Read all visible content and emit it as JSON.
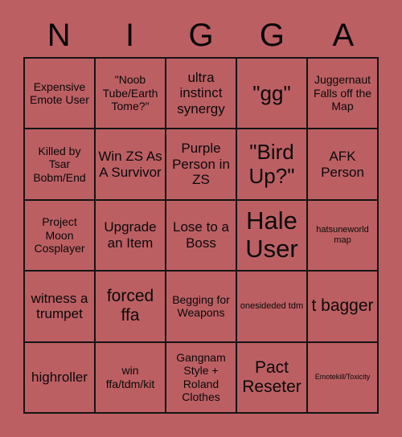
{
  "colors": {
    "background": "#bc5f63",
    "cell_background": "#bc5f63",
    "border": "#141414",
    "text": "#0a0a0a"
  },
  "header": {
    "letters": [
      "N",
      "I",
      "G",
      "G",
      "A"
    ]
  },
  "grid": {
    "columns": 5,
    "rows": 5,
    "cells": [
      {
        "text": "Expensive Emote User",
        "size": "m"
      },
      {
        "text": "\"Noob Tube/Earth Tome?\"",
        "size": "m"
      },
      {
        "text": "ultra instinct synergy",
        "size": "l"
      },
      {
        "text": "\"gg\"",
        "size": "xxl"
      },
      {
        "text": "Juggernaut Falls off the Map",
        "size": "m"
      },
      {
        "text": "Killed by Tsar Bobm/End",
        "size": "m"
      },
      {
        "text": "Win ZS As A Survivor",
        "size": "l"
      },
      {
        "text": "Purple Person in ZS",
        "size": "l"
      },
      {
        "text": "\"Bird Up?\"",
        "size": "xxl"
      },
      {
        "text": "AFK Person",
        "size": "l"
      },
      {
        "text": "Project Moon Cosplayer",
        "size": "m"
      },
      {
        "text": "Upgrade an Item",
        "size": "l"
      },
      {
        "text": "Lose to a Boss",
        "size": "l"
      },
      {
        "text": "Hale User",
        "size": "xxxl"
      },
      {
        "text": "hatsuneworld map",
        "size": "s"
      },
      {
        "text": "witness a trumpet",
        "size": "l"
      },
      {
        "text": "forced ffa",
        "size": "xl"
      },
      {
        "text": "Begging for Weapons",
        "size": "m"
      },
      {
        "text": "onesideded tdm",
        "size": "s"
      },
      {
        "text": "t bagger",
        "size": "xl"
      },
      {
        "text": "highroller",
        "size": "l"
      },
      {
        "text": "win ffa/tdm/kit",
        "size": "m"
      },
      {
        "text": "Gangnam Style + Roland Clothes",
        "size": "m"
      },
      {
        "text": "Pact Reseter",
        "size": "xl"
      },
      {
        "text": "Emotekill/Toxicity",
        "size": "xs"
      }
    ]
  }
}
